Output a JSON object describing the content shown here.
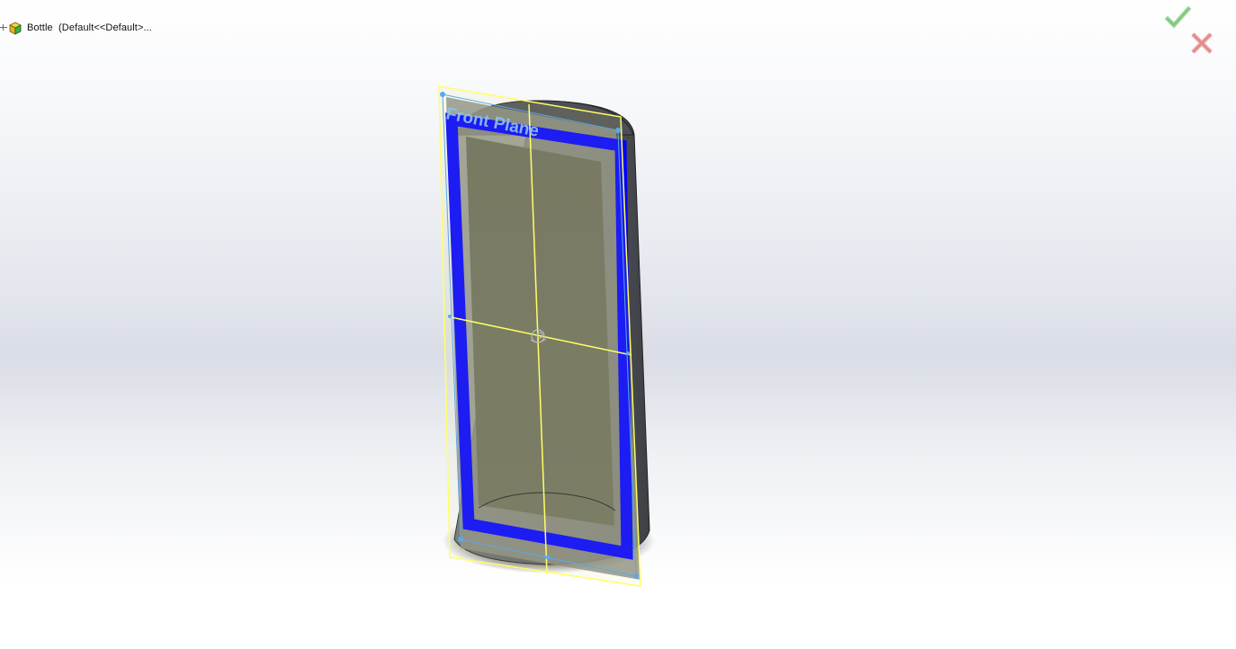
{
  "feature_tree": {
    "part_label": "Bottle  (Default<<Default>...",
    "part_icon": "part-icon"
  },
  "confirm_corner": {
    "ok_icon": "checkmark-icon",
    "cancel_icon": "close-icon",
    "ok_color": "#7fc97f",
    "cancel_color": "#e08a8a"
  },
  "graphics_area": {
    "plane_label": "Front Plane",
    "sketch_color": "#0000ff",
    "plane_border_color": "#ffff66",
    "plane_edge_color": "#5aa9e6",
    "model_face_color": "#6b6d5d"
  }
}
